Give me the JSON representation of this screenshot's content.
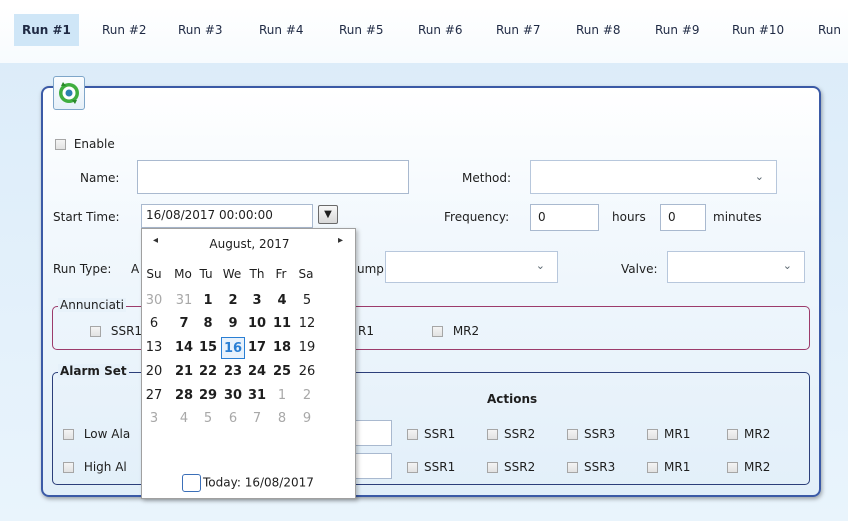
{
  "tabs": [
    "Run #1",
    "Run #2",
    "Run #3",
    "Run #4",
    "Run #5",
    "Run #6",
    "Run #7",
    "Run #8",
    "Run #9",
    "Run #10",
    "Run"
  ],
  "form": {
    "enable_label": "Enable",
    "name_label": "Name:",
    "name_value": "",
    "method_label": "Method:",
    "method_value": "",
    "start_time_label": "Start Time:",
    "start_time_value": "16/08/2017 00:00:00",
    "frequency_label": "Frequency:",
    "frequency_hours": "0",
    "hours_label": "hours",
    "frequency_minutes": "0",
    "minutes_label": "minutes",
    "run_type_label": "Run Type:",
    "run_type_value": "A",
    "pump_label": "ump",
    "pump_value": "",
    "valve_label": "Valve:",
    "valve_value": ""
  },
  "annunciation": {
    "title": "Annunciati",
    "items": [
      "SSR1",
      "R1",
      "MR2"
    ]
  },
  "alarm": {
    "title": "Alarm Set",
    "actions_label": "Actions",
    "rows": [
      {
        "label": "Low Ala",
        "actions": [
          "SSR1",
          "SSR2",
          "SSR3",
          "MR1",
          "MR2"
        ]
      },
      {
        "label": "High Al",
        "actions": [
          "SSR1",
          "SSR2",
          "SSR3",
          "MR1",
          "MR2"
        ]
      }
    ]
  },
  "calendar": {
    "month_label": "August, 2017",
    "prev": "◂",
    "next": "▸",
    "weekdays": [
      "Su",
      "Mo",
      "Tu",
      "We",
      "Th",
      "Fr",
      "Sa"
    ],
    "weeks": [
      [
        "30",
        "31",
        "1",
        "2",
        "3",
        "4",
        "5"
      ],
      [
        "6",
        "7",
        "8",
        "9",
        "10",
        "11",
        "12"
      ],
      [
        "13",
        "14",
        "15",
        "16",
        "17",
        "18",
        "19"
      ],
      [
        "20",
        "21",
        "22",
        "23",
        "24",
        "25",
        "26"
      ],
      [
        "27",
        "28",
        "29",
        "30",
        "31",
        "1",
        "2"
      ],
      [
        "3",
        "4",
        "5",
        "6",
        "7",
        "8",
        "9"
      ]
    ],
    "selected": "16",
    "today_label": "Today: 16/08/2017"
  },
  "colors": {
    "accent": "#3b5aa6",
    "selected_day": "#2a7fd4",
    "annunciation_border": "#9c3b6b"
  }
}
